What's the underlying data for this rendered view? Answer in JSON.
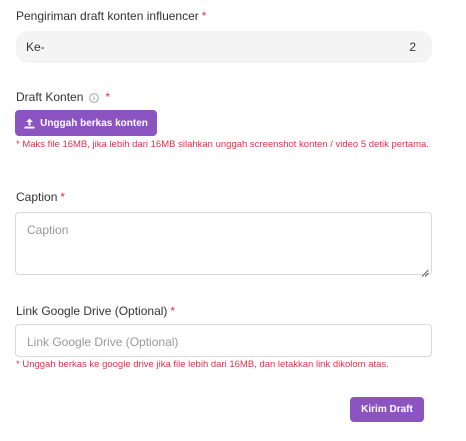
{
  "draft_field": {
    "label": "Pengiriman draft konten influencer",
    "required_mark": "*",
    "prefix": "Ke-",
    "value": "2"
  },
  "konten_field": {
    "label": "Draft Konten",
    "required_mark": "*",
    "info_icon": "info-circle-icon",
    "upload_label": "Unggah berkas konten",
    "upload_icon": "upload-icon",
    "helper": "* Maks file 16MB, jika lebih dari 16MB silahkan unggah screenshot konten / video 5 detik pertama."
  },
  "caption_field": {
    "label": "Caption",
    "required_mark": "*",
    "placeholder": "Caption"
  },
  "link_field": {
    "label": "Link Google Drive (Optional)",
    "required_mark": "*",
    "placeholder": "Link Google Drive (Optional)",
    "helper": "* Unggah berkas ke google drive jika file lebih dari 16MB, dan letakkan link dikolom atas."
  },
  "submit": {
    "label": "Kirim Draft"
  },
  "colors": {
    "accent": "#8c54c0",
    "required": "#e0344a"
  }
}
